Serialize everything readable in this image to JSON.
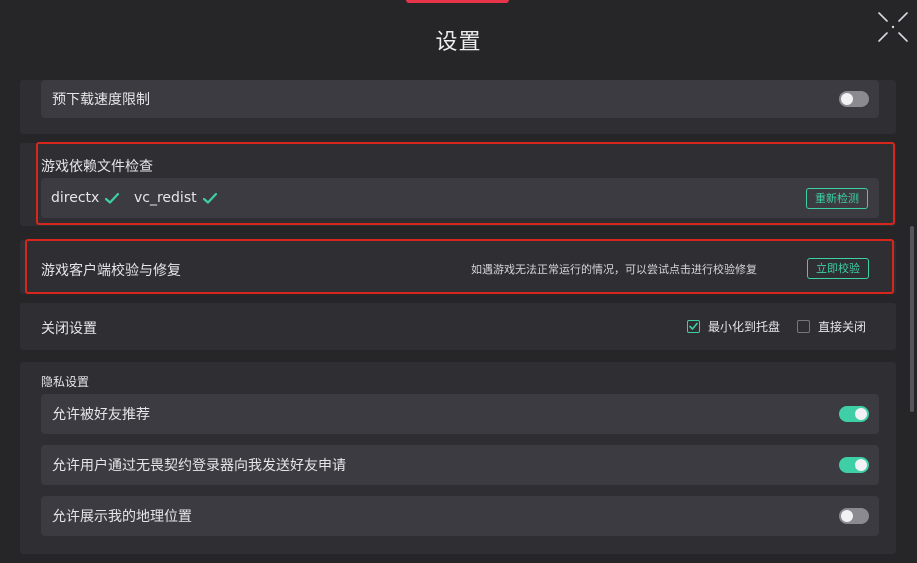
{
  "window": {
    "title": "设置",
    "collapse_icon": "collapse-arrows-icon"
  },
  "download": {
    "pre_download_limit_label": "预下载速度限制",
    "pre_download_limit_on": false
  },
  "dependencies": {
    "section_title": "游戏依赖文件检查",
    "items": [
      {
        "name": "directx",
        "status_icon": "check-icon"
      },
      {
        "name": "vc_redist",
        "status_icon": "check-icon"
      }
    ],
    "recheck_label": "重新检测"
  },
  "repair": {
    "title": "游戏客户端校验与修复",
    "hint": "如遇游戏无法正常运行的情况，可以尝试点击进行校验修复",
    "verify_label": "立即校验"
  },
  "close_settings": {
    "title": "关闭设置",
    "options": [
      {
        "label": "最小化到托盘",
        "checked": true
      },
      {
        "label": "直接关闭",
        "checked": false
      }
    ]
  },
  "privacy": {
    "section_title": "隐私设置",
    "items": [
      {
        "label": "允许被好友推荐",
        "on": true
      },
      {
        "label": "允许用户通过无畏契约登录器向我发送好友申请",
        "on": true
      },
      {
        "label": "允许展示我的地理位置",
        "on": false
      }
    ]
  },
  "colors": {
    "accent": "#3ecfa6",
    "highlight_frame": "#d9261c",
    "top_accent": "#e8344a"
  }
}
